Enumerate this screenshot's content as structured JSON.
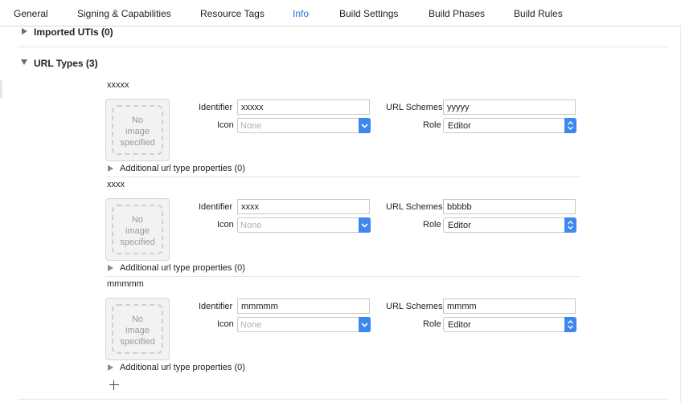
{
  "tabs": [
    {
      "label": "General"
    },
    {
      "label": "Signing & Capabilities"
    },
    {
      "label": "Resource Tags"
    },
    {
      "label": "Info"
    },
    {
      "label": "Build Settings"
    },
    {
      "label": "Build Phases"
    },
    {
      "label": "Build Rules"
    }
  ],
  "active_tab": "Info",
  "sections": {
    "imported_utis": {
      "title": "Imported UTIs (0)",
      "expanded": false
    },
    "url_types": {
      "title": "URL Types (3)",
      "expanded": true
    }
  },
  "labels": {
    "identifier": "Identifier",
    "icon": "Icon",
    "url_schemes": "URL Schemes",
    "role": "Role",
    "no_image_line1": "No",
    "no_image_line2": "image",
    "no_image_line3": "specified",
    "additional_props": "Additional url type properties (0)"
  },
  "url_types": [
    {
      "name": "xxxxx",
      "identifier": "xxxxx",
      "icon_placeholder": "None",
      "url_schemes": "yyyyy",
      "role": "Editor"
    },
    {
      "name": "xxxx",
      "identifier": "xxxx",
      "icon_placeholder": "None",
      "url_schemes": "bbbbb",
      "role": "Editor"
    },
    {
      "name": "mmmmm",
      "identifier": "mmmmm",
      "icon_placeholder": "None",
      "url_schemes": "mmmm",
      "role": "Editor"
    }
  ],
  "colors": {
    "accent": "#2d6bd6",
    "popup_button": "#3f87f0"
  },
  "icons": {
    "add": "plus-icon",
    "popup": "chevron-updown-icon",
    "disclosure": "disclosure-triangle-icon"
  }
}
